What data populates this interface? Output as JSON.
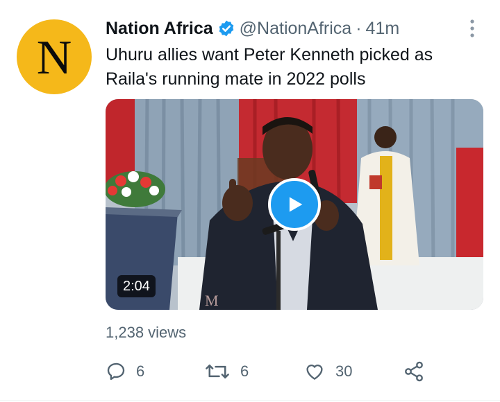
{
  "account": {
    "avatar_letter": "N",
    "display_name": "Nation Africa",
    "handle": "@NationAfrica",
    "separator": "·",
    "time": "41m",
    "verified": true
  },
  "tweet": {
    "text": "Uhuru allies want Peter Kenneth picked as Raila's running mate in 2022 polls"
  },
  "media": {
    "type": "video",
    "duration": "2:04",
    "play_icon": "play-icon"
  },
  "stats": {
    "views": "1,238 views"
  },
  "actions": {
    "reply_count": "6",
    "retweet_count": "6",
    "like_count": "30"
  },
  "colors": {
    "accent": "#1d9bf0",
    "avatar_bg": "#f5b81a",
    "secondary_text": "#536471"
  }
}
